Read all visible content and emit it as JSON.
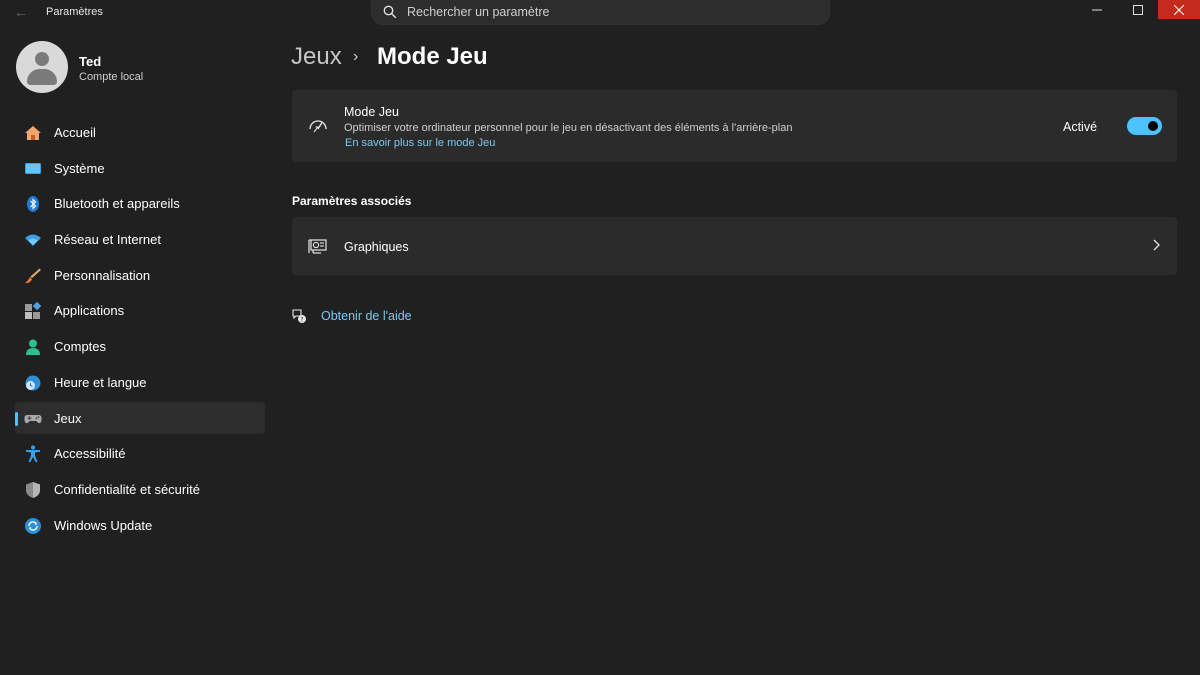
{
  "app": {
    "title": "Paramètres",
    "search_placeholder": "Rechercher un paramètre"
  },
  "user": {
    "name": "Ted",
    "account_type": "Compte local"
  },
  "sidebar": {
    "items": [
      {
        "label": "Accueil",
        "icon": "home-icon"
      },
      {
        "label": "Système",
        "icon": "system-icon"
      },
      {
        "label": "Bluetooth et appareils",
        "icon": "bluetooth-icon"
      },
      {
        "label": "Réseau et Internet",
        "icon": "wifi-icon"
      },
      {
        "label": "Personnalisation",
        "icon": "brush-icon"
      },
      {
        "label": "Applications",
        "icon": "apps-icon"
      },
      {
        "label": "Comptes",
        "icon": "account-icon"
      },
      {
        "label": "Heure et langue",
        "icon": "globe-clock-icon"
      },
      {
        "label": "Jeux",
        "icon": "gamepad-icon",
        "selected": true
      },
      {
        "label": "Accessibilité",
        "icon": "accessibility-icon"
      },
      {
        "label": "Confidentialité et sécurité",
        "icon": "shield-icon"
      },
      {
        "label": "Windows Update",
        "icon": "update-icon"
      }
    ]
  },
  "breadcrumb": {
    "parent": "Jeux",
    "separator": "›",
    "current": "Mode Jeu"
  },
  "game_mode": {
    "title": "Mode Jeu",
    "description": "Optimiser votre ordinateur personnel pour le jeu en désactivant des éléments à l'arrière-plan",
    "link": "En savoir plus sur le mode Jeu",
    "state_label": "Activé",
    "enabled": true
  },
  "related": {
    "heading": "Paramètres associés",
    "graphics_label": "Graphiques"
  },
  "help": {
    "label": "Obtenir de l'aide"
  },
  "colors": {
    "accent": "#4cc2ff",
    "background": "#202020",
    "card": "#2b2b2b",
    "close_button": "#c42b1c",
    "link": "#7cc8f2"
  }
}
